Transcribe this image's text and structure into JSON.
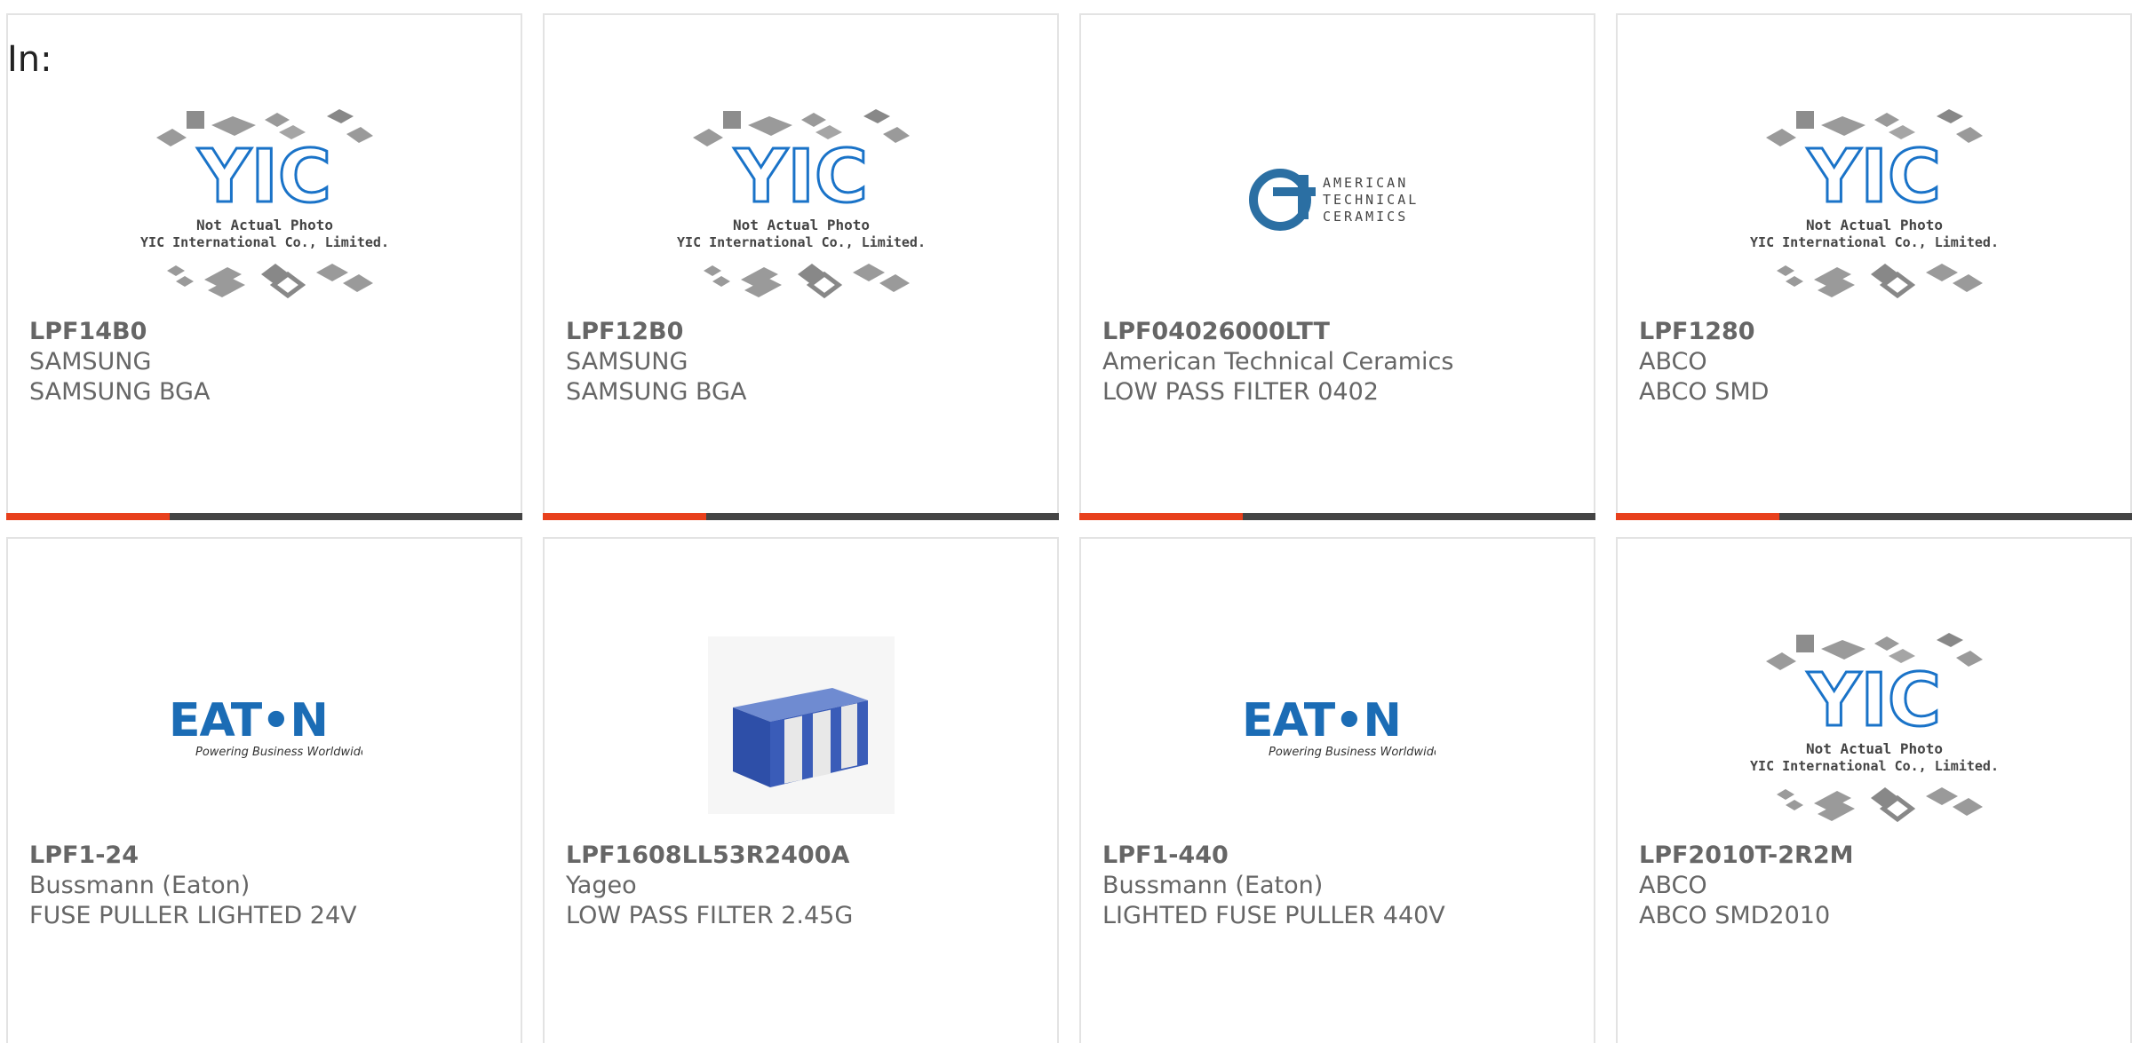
{
  "filter_label": "In:",
  "image_text": {
    "yic_logo": "YIC",
    "yic_line1": "Not Actual Photo",
    "yic_line2": "YIC International Co., Limited.",
    "atc_line1": "AMERICAN",
    "atc_line2": "TECHNICAL",
    "atc_line3": "CERAMICS",
    "eaton_logo": "EAT•N",
    "eaton_tagline": "Powering Business Worldwide"
  },
  "products": [
    {
      "part": "LPF14B0",
      "manufacturer": "SAMSUNG",
      "description": "SAMSUNG BGA",
      "image": "yic-placeholder"
    },
    {
      "part": "LPF12B0",
      "manufacturer": "SAMSUNG",
      "description": "SAMSUNG BGA",
      "image": "yic-placeholder"
    },
    {
      "part": "LPF04026000LTT",
      "manufacturer": "American Technical Ceramics",
      "description": "LOW PASS FILTER 0402",
      "image": "atc-logo"
    },
    {
      "part": "LPF1280",
      "manufacturer": "ABCO",
      "description": "ABCO SMD",
      "image": "yic-placeholder"
    },
    {
      "part": "LPF1-24",
      "manufacturer": "Bussmann (Eaton)",
      "description": "FUSE PULLER LIGHTED 24V",
      "image": "eaton-logo"
    },
    {
      "part": "LPF1608LL53R2400A",
      "manufacturer": "Yageo",
      "description": "LOW PASS FILTER 2.45G",
      "image": "chip-photo"
    },
    {
      "part": "LPF1-440",
      "manufacturer": "Bussmann (Eaton)",
      "description": "LIGHTED FUSE PULLER 440V",
      "image": "eaton-logo"
    },
    {
      "part": "LPF2010T-2R2M",
      "manufacturer": "ABCO",
      "description": "ABCO SMD2010",
      "image": "yic-placeholder"
    }
  ],
  "colors": {
    "accent": "#e8401c",
    "bar": "#444444",
    "text": "#666666",
    "eaton_blue": "#1b6cb5",
    "yic_blue": "#1a73c8",
    "card_border": "#e3e3e3"
  }
}
